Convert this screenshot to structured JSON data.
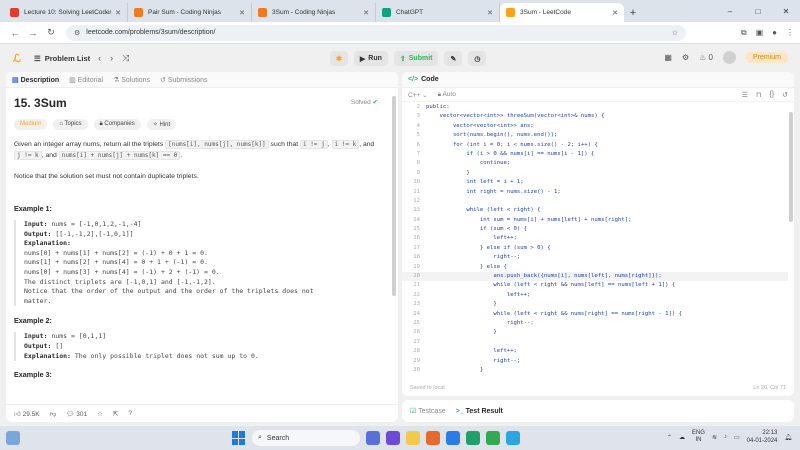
{
  "browser": {
    "tabs": [
      {
        "title": "Lecture 10: Solving LeetCode/C...",
        "color": "#e33b2e"
      },
      {
        "title": "Pair Sum - Coding Ninjas",
        "color": "#f07a22"
      },
      {
        "title": "3Sum - Coding Ninjas",
        "color": "#f07a22"
      },
      {
        "title": "ChatGPT",
        "color": "#10a37f"
      },
      {
        "title": "3Sum - LeetCode",
        "color": "#ffa116"
      }
    ],
    "url": "leetcode.com/problems/3sum/description/"
  },
  "topbar": {
    "problem_list": "Problem List",
    "run": "Run",
    "submit": "Submit",
    "coins": "0",
    "premium": "Premium"
  },
  "left": {
    "tabs": [
      "Description",
      "Editorial",
      "Solutions",
      "Submissions"
    ],
    "title": "15. 3Sum",
    "solved": "Solved",
    "chips": [
      "Medium",
      "Topics",
      "Companies",
      "Hint"
    ],
    "desc1_a": "Given an integer array nums, return all the triplets ",
    "code1": "[nums[i], nums[j], nums[k]]",
    "desc1_b": " such that ",
    "code2": "i != j",
    "code3": "i != k",
    "code4": "j != k",
    "desc1_c": ", and ",
    "code5": "nums[i] + nums[j] + nums[k] == 0",
    "desc2": "Notice that the solution set must not contain duplicate triplets.",
    "example1": {
      "title": "Example 1:",
      "input_label": "Input:",
      "input": " nums = [-1,0,1,2,-1,-4]",
      "output_label": "Output:",
      "output": " [[-1,-1,2],[-1,0,1]]",
      "expl_label": "Explanation:",
      "lines": [
        "nums[0] + nums[1] + nums[2] = (-1) + 0 + 1 = 0.",
        "nums[1] + nums[2] + nums[4] = 0 + 1 + (-1) = 0.",
        "nums[0] + nums[3] + nums[4] = (-1) + 2 + (-1) = 0.",
        "The distinct triplets are [-1,0,1] and [-1,-1,2].",
        "Notice that the order of the output and the order of the triplets does not",
        "matter."
      ]
    },
    "example2": {
      "title": "Example 2:",
      "input_label": "Input:",
      "input": " nums = [0,1,1]",
      "output_label": "Output:",
      "output": " []",
      "expl_label": "Explanation:",
      "expl": " The only possible triplet does not sum up to 0."
    },
    "example3_title": "Example 3:",
    "footer": {
      "likes": "29.5K",
      "comments": "301"
    }
  },
  "right": {
    "header": "Code",
    "language": "C++",
    "mode": "Auto",
    "code_lines": [
      {
        "n": "2",
        "t": "public:"
      },
      {
        "n": "3",
        "t": "    vector<vector<int>> threeSum(vector<int>& nums) {"
      },
      {
        "n": "4",
        "t": "        vector<vector<int>> ans;"
      },
      {
        "n": "5",
        "t": "        sort(nums.begin(), nums.end());"
      },
      {
        "n": "6",
        "t": "        for (int i = 0; i < nums.size() - 2; i++) {"
      },
      {
        "n": "7",
        "t": "            if (i > 0 && nums[i] == nums[i - 1]) {"
      },
      {
        "n": "8",
        "t": "                continue;"
      },
      {
        "n": "9",
        "t": "            }"
      },
      {
        "n": "10",
        "t": "            int left = i + 1;"
      },
      {
        "n": "11",
        "t": "            int right = nums.size() - 1;"
      },
      {
        "n": "12",
        "t": ""
      },
      {
        "n": "13",
        "t": "            while (left < right) {"
      },
      {
        "n": "14",
        "t": "                int sum = nums[i] + nums[left] + nums[right];"
      },
      {
        "n": "15",
        "t": "                if (sum < 0) {"
      },
      {
        "n": "16",
        "t": "                    left++;"
      },
      {
        "n": "17",
        "t": "                } else if (sum > 0) {"
      },
      {
        "n": "18",
        "t": "                    right--;"
      },
      {
        "n": "19",
        "t": "                } else {"
      },
      {
        "n": "20",
        "t": "                    ans.push_back({nums[i], nums[left], nums[right]});"
      },
      {
        "n": "21",
        "t": "                    while (left < right && nums[left] == nums[left + 1]) {"
      },
      {
        "n": "22",
        "t": "                        left++;"
      },
      {
        "n": "23",
        "t": "                    }"
      },
      {
        "n": "24",
        "t": "                    while (left < right && nums[right] == nums[right - 1]) {"
      },
      {
        "n": "25",
        "t": "                        right--;"
      },
      {
        "n": "26",
        "t": "                    }"
      },
      {
        "n": "27",
        "t": ""
      },
      {
        "n": "28",
        "t": "                    left++;"
      },
      {
        "n": "29",
        "t": "                    right--;"
      },
      {
        "n": "30",
        "t": "                }"
      }
    ],
    "saved": "Saved to local",
    "position": "Ln 20, Col 71"
  },
  "bottom": {
    "testcase": "Testcase",
    "result": "Test Result"
  },
  "taskbar": {
    "search": "Search",
    "lang1": "ENG",
    "lang2": "IN",
    "time": "22:13",
    "date": "04-01-2024"
  }
}
